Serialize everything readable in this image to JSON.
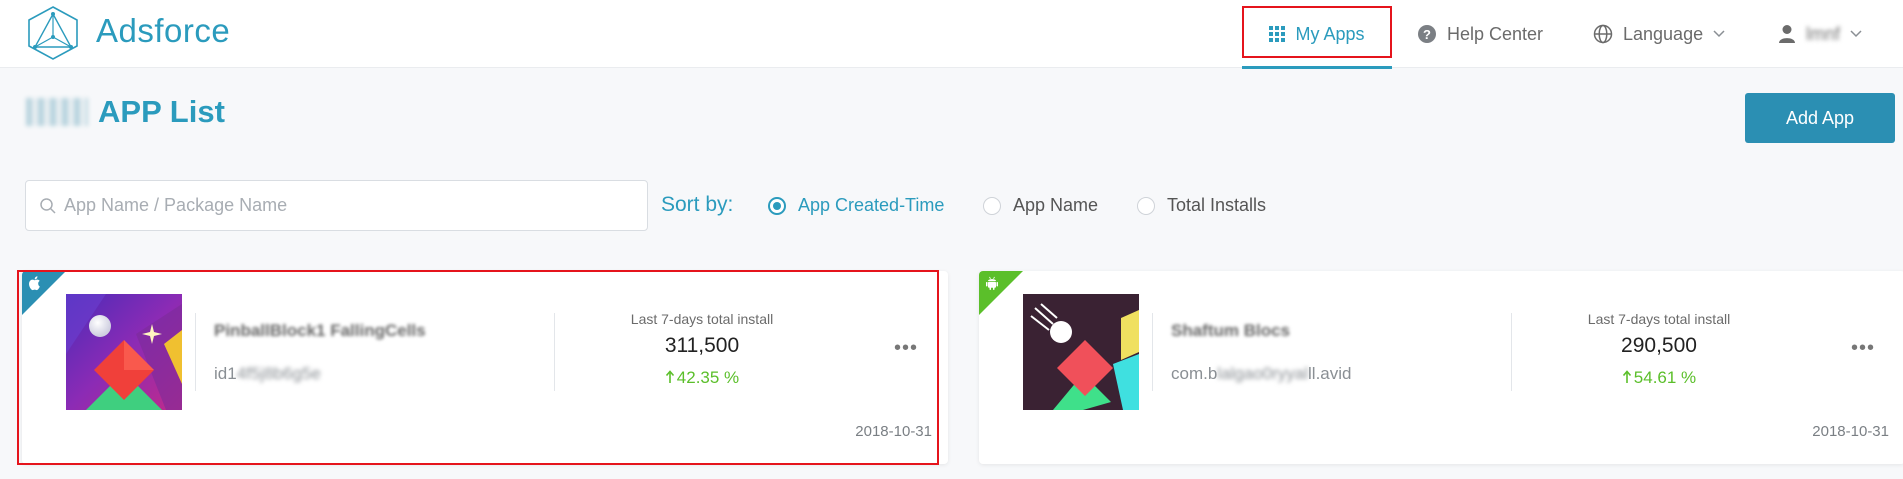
{
  "header": {
    "brand": "Adsforce",
    "nav": {
      "my_apps": "My Apps",
      "help_center": "Help Center",
      "language": "Language",
      "user": "lmnf"
    }
  },
  "page": {
    "title_prefix": "kl1fs",
    "title": "APP List",
    "add_button": "Add App"
  },
  "search": {
    "placeholder": "App Name / Package Name",
    "value": ""
  },
  "sort": {
    "label": "Sort by:",
    "options": [
      "App Created-Time",
      "App Name",
      "Total Installs"
    ],
    "selected": "App Created-Time"
  },
  "apps": [
    {
      "platform": "ios",
      "name": "PinballBlock1 FallingCells",
      "id_prefix": "id1",
      "id_blurred": "4f5j8b6g5e",
      "id_suffix": "",
      "stat_label": "Last 7-days total install",
      "installs": "311,500",
      "growth": "42.35 %",
      "date": "2018-10-31"
    },
    {
      "platform": "android",
      "name": "Shaftum Blocs",
      "id_prefix": "com.b",
      "id_blurred": "lalgao0ryyal",
      "id_suffix": "ll.avid",
      "stat_label": "Last 7-days total install",
      "installs": "290,500",
      "growth": "54.61 %",
      "date": "2018-10-31"
    }
  ],
  "colors": {
    "accent": "#2b9bbd",
    "button": "#2b8fb3",
    "highlight": "#e5141c",
    "growth": "#5bbf2a",
    "android": "#5bbf2a"
  }
}
